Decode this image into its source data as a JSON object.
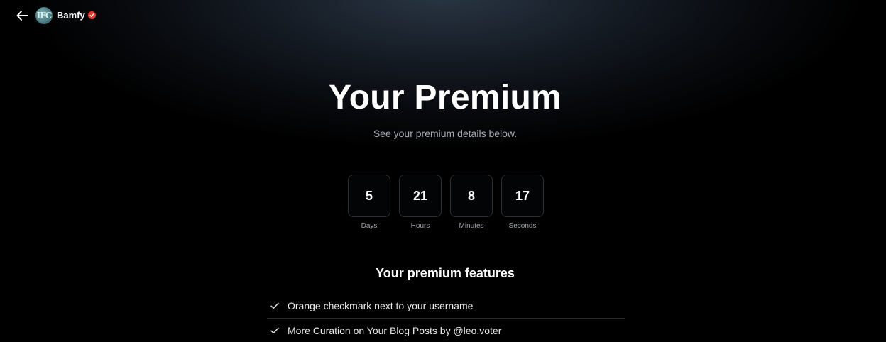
{
  "header": {
    "back_icon": "arrow-left-icon",
    "avatar_initials": "IFC",
    "username": "Bamfy",
    "verified_icon": "verified-check-icon",
    "verified_color": "#e8372c"
  },
  "main": {
    "title": "Your Premium",
    "subtitle": "See your premium details below."
  },
  "countdown": [
    {
      "value": "5",
      "label": "Days"
    },
    {
      "value": "21",
      "label": "Hours"
    },
    {
      "value": "8",
      "label": "Minutes"
    },
    {
      "value": "17",
      "label": "Seconds"
    }
  ],
  "features": {
    "title": "Your premium features",
    "items": [
      {
        "icon": "check-icon",
        "text": "Orange checkmark next to your username"
      },
      {
        "icon": "check-icon",
        "text": "More Curation on Your Blog Posts by @leo.voter"
      }
    ]
  }
}
